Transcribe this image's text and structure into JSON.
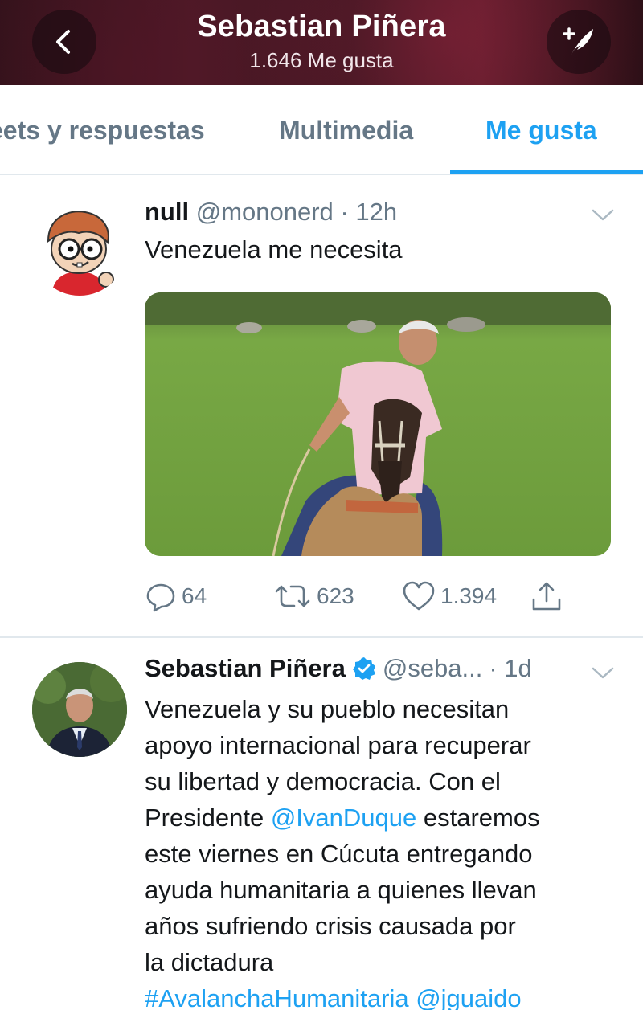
{
  "header": {
    "title": "Sebastian Piñera",
    "subtitle": "1.646 Me gusta",
    "back_icon": "chevron-left-icon",
    "compose_icon": "compose-quill-icon"
  },
  "tabs": [
    {
      "label": "eets y respuestas",
      "active": false
    },
    {
      "label": "Multimedia",
      "active": false
    },
    {
      "label": "Me gusta",
      "active": true
    }
  ],
  "colors": {
    "accent": "#1da1f2",
    "muted": "#657786",
    "text": "#14171a"
  },
  "tweets": [
    {
      "author": "null",
      "handle": "@mononerd",
      "time": "· 12h",
      "text": "Venezuela me necesita",
      "has_photo": true,
      "actions": {
        "replies": "64",
        "retweets": "623",
        "likes": "1.394"
      }
    },
    {
      "author": "Sebastian Piñera",
      "verified": true,
      "handle": "@seba...",
      "time": "· 1d",
      "text_lines": [
        "Venezuela y su pueblo necesitan",
        "apoyo internacional para recuperar",
        "su libertad y democracia. Con el"
      ],
      "line4_prefix": "Presidente ",
      "line4_mention": "@IvanDuque",
      "line4_suffix": " estaremos",
      "text_lines_b": [
        "este viernes en Cúcuta entregando",
        "ayuda humanitaria a quienes llevan",
        "años sufriendo crisis causada por",
        "la dictadura"
      ],
      "hashtag": "#AvalanchaHumanitaria",
      "mention2": "@jguaido"
    }
  ]
}
